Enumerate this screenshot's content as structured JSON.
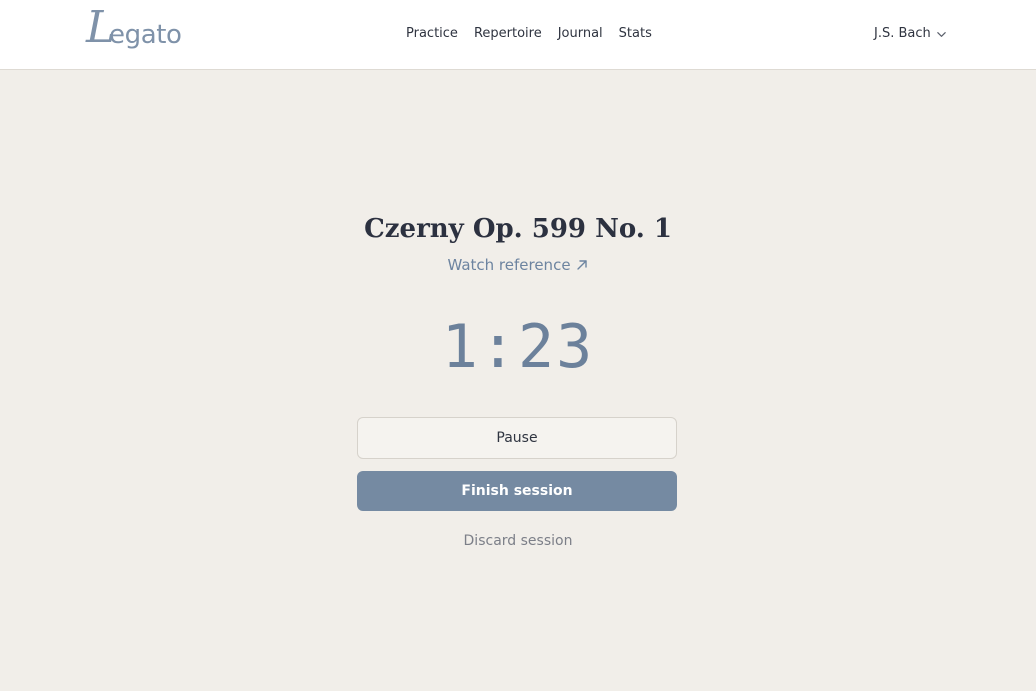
{
  "header": {
    "logo": {
      "initial": "L",
      "rest": "egato"
    },
    "nav": [
      {
        "label": "Practice"
      },
      {
        "label": "Repertoire"
      },
      {
        "label": "Journal"
      },
      {
        "label": "Stats"
      }
    ],
    "user": {
      "name": "J.S. Bach",
      "icon": "chevron-down-icon"
    }
  },
  "session": {
    "piece_title": "Czerny Op. 599 No. 1",
    "reference_label": "Watch reference",
    "reference_icon": "external-link-arrow-icon",
    "timer": "1:23",
    "pause_label": "Pause",
    "finish_label": "Finish session",
    "discard_label": "Discard session"
  },
  "colors": {
    "accent": "#758aa2",
    "background": "#f1eee9",
    "header_background": "#ffffff",
    "link": "#6d84a0",
    "timer": "#6c819b"
  }
}
